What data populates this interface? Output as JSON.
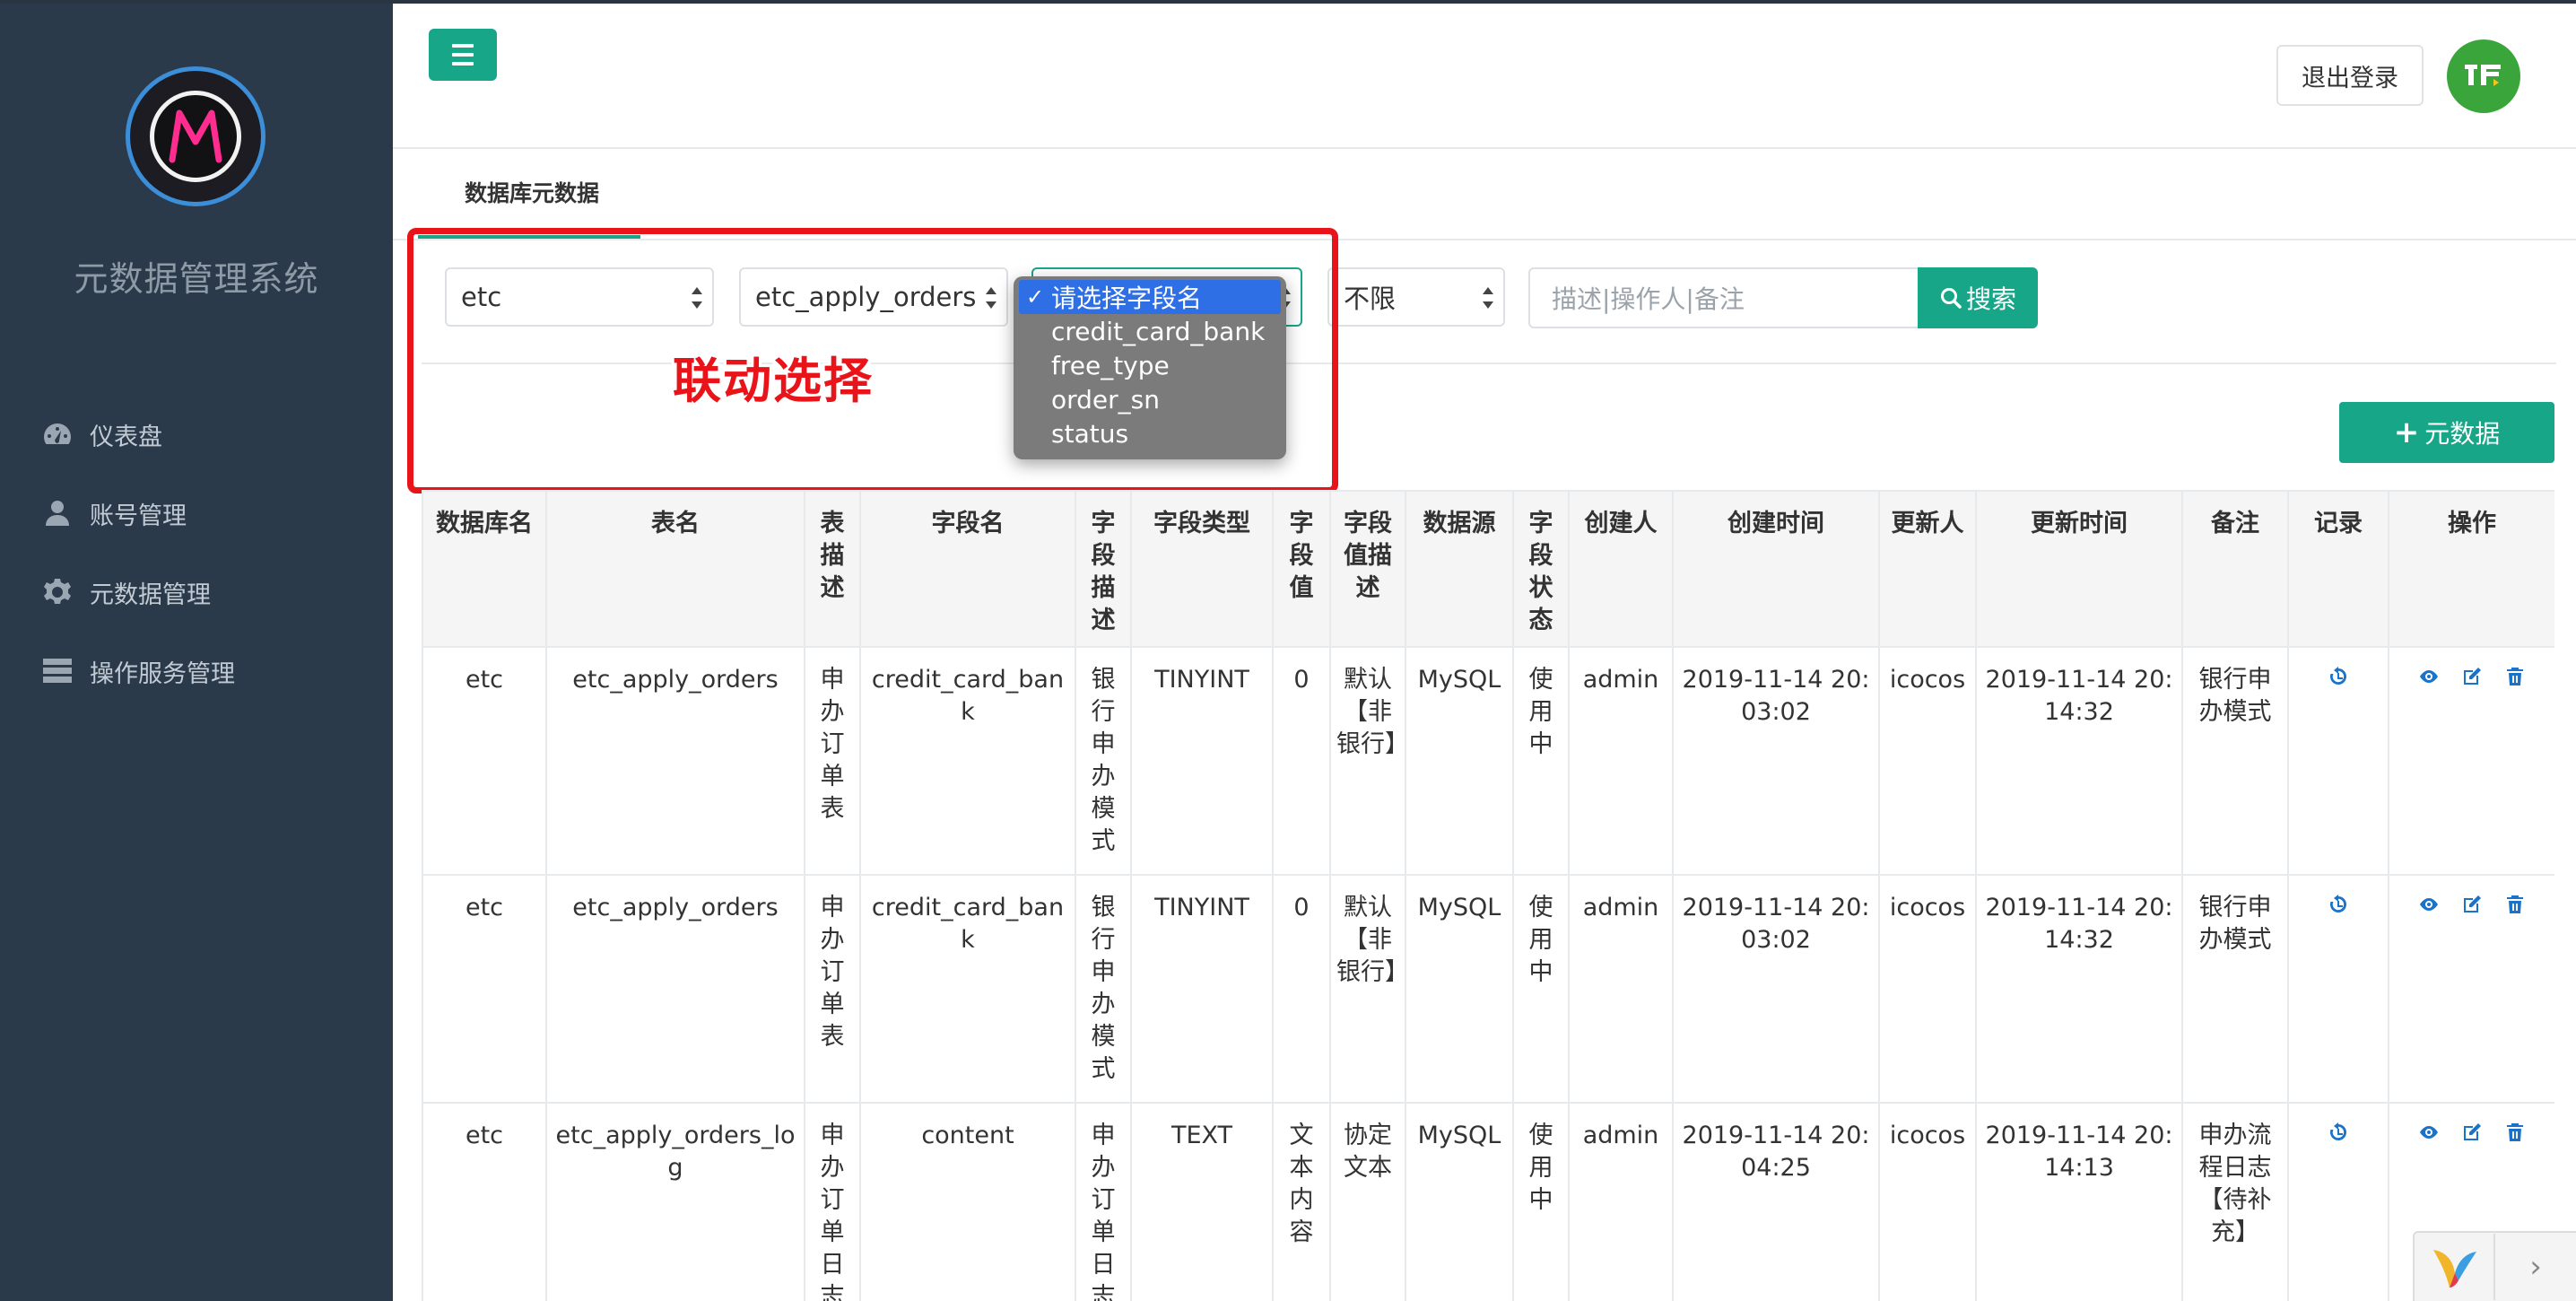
{
  "app": {
    "title": "元数据管理系统"
  },
  "sidebar": {
    "items": [
      {
        "label": "仪表盘",
        "icon": "dashboard-icon"
      },
      {
        "label": "账号管理",
        "icon": "user-icon"
      },
      {
        "label": "元数据管理",
        "icon": "gear-icon"
      },
      {
        "label": "操作服务管理",
        "icon": "server-icon"
      }
    ]
  },
  "header": {
    "logout_label": "退出登录"
  },
  "page": {
    "tab_label": "数据库元数据",
    "add_button_label": "元数据",
    "annotation": "联动选择"
  },
  "filters": {
    "database_value": "etc",
    "table_value": "etc_apply_orders",
    "status_value": "不限",
    "search_placeholder": "描述|操作人|备注",
    "search_button_label": "搜索"
  },
  "field_dropdown": {
    "options": [
      "请选择字段名",
      "credit_card_bank",
      "free_type",
      "order_sn",
      "status"
    ],
    "selected_index": 0
  },
  "table": {
    "headers": [
      "数据库名",
      "表名",
      "表描述",
      "字段名",
      "字段描述",
      "字段类型",
      "字段值",
      "字段值描述",
      "数据源",
      "字段状态",
      "创建人",
      "创建时间",
      "更新人",
      "更新时间",
      "备注",
      "记录",
      "操作"
    ],
    "rows": [
      {
        "db": "etc",
        "table": "etc_apply_orders",
        "table_desc": "申办订单表",
        "field": "credit_card_bank",
        "field_desc": "银行申办模式",
        "type": "TINYINT",
        "value": "0",
        "value_desc": "默认【非银行】",
        "source": "MySQL",
        "state": "使用中",
        "creator": "admin",
        "created": "2019-11-14 20:03:02",
        "updater": "icocos",
        "updated": "2019-11-14 20:14:32",
        "remark": "银行申办模式"
      },
      {
        "db": "etc",
        "table": "etc_apply_orders",
        "table_desc": "申办订单表",
        "field": "credit_card_bank",
        "field_desc": "银行申办模式",
        "type": "TINYINT",
        "value": "0",
        "value_desc": "默认【非银行】",
        "source": "MySQL",
        "state": "使用中",
        "creator": "admin",
        "created": "2019-11-14 20:03:02",
        "updater": "icocos",
        "updated": "2019-11-14 20:14:32",
        "remark": "银行申办模式"
      },
      {
        "db": "etc",
        "table": "etc_apply_orders_log",
        "table_desc": "申办订单日志",
        "field": "content",
        "field_desc": "申办订单日志",
        "type": "TEXT",
        "value": "文本内容",
        "value_desc": "协定文本",
        "source": "MySQL",
        "state": "使用中",
        "creator": "admin",
        "created": "2019-11-14 20:04:25",
        "updater": "icocos",
        "updated": "2019-11-14 20:14:13",
        "remark": "申办流程日志【待补充】"
      }
    ]
  },
  "colors": {
    "sidebar_bg": "#2b3a4a",
    "accent": "#18a689",
    "annotation_red": "#e8141a",
    "icon_blue": "#1a73c9"
  }
}
